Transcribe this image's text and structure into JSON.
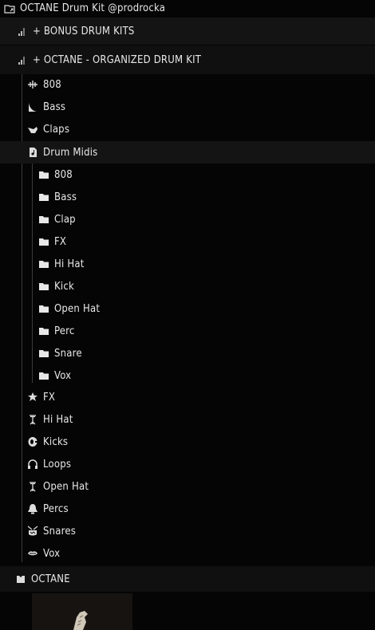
{
  "root": {
    "label": "OCTANE Drum Kit @prodrocka",
    "icon": "folder-link-icon"
  },
  "groups": [
    {
      "label": "+ BONUS DRUM KITS",
      "icon": "signal-bars-icon"
    },
    {
      "label": "+ OCTANE - ORGANIZED DRUM KIT",
      "icon": "signal-bars-icon"
    }
  ],
  "categories": [
    {
      "label": "808",
      "icon": "waveform-icon"
    },
    {
      "label": "Bass",
      "icon": "bass-ramp-icon"
    },
    {
      "label": "Claps",
      "icon": "clap-hand-icon"
    },
    {
      "label": "Drum Midis",
      "icon": "midi-file-icon"
    }
  ],
  "midi_folders": [
    "808",
    "Bass",
    "Clap",
    "FX",
    "Hi Hat",
    "Kick",
    "Open Hat",
    "Perc",
    "Snare",
    "Vox"
  ],
  "categories_after": [
    {
      "label": "FX",
      "icon": "star-icon"
    },
    {
      "label": "Hi Hat",
      "icon": "hihat-icon"
    },
    {
      "label": "Kicks",
      "icon": "kick-drum-icon"
    },
    {
      "label": "Loops",
      "icon": "headphones-icon"
    },
    {
      "label": "Open Hat",
      "icon": "hihat-icon"
    },
    {
      "label": "Percs",
      "icon": "bell-icon"
    },
    {
      "label": "Snares",
      "icon": "snare-drum-icon"
    },
    {
      "label": "Vox",
      "icon": "lips-icon"
    }
  ],
  "bottom": {
    "label": "OCTANE",
    "icon": "pack-icon"
  }
}
